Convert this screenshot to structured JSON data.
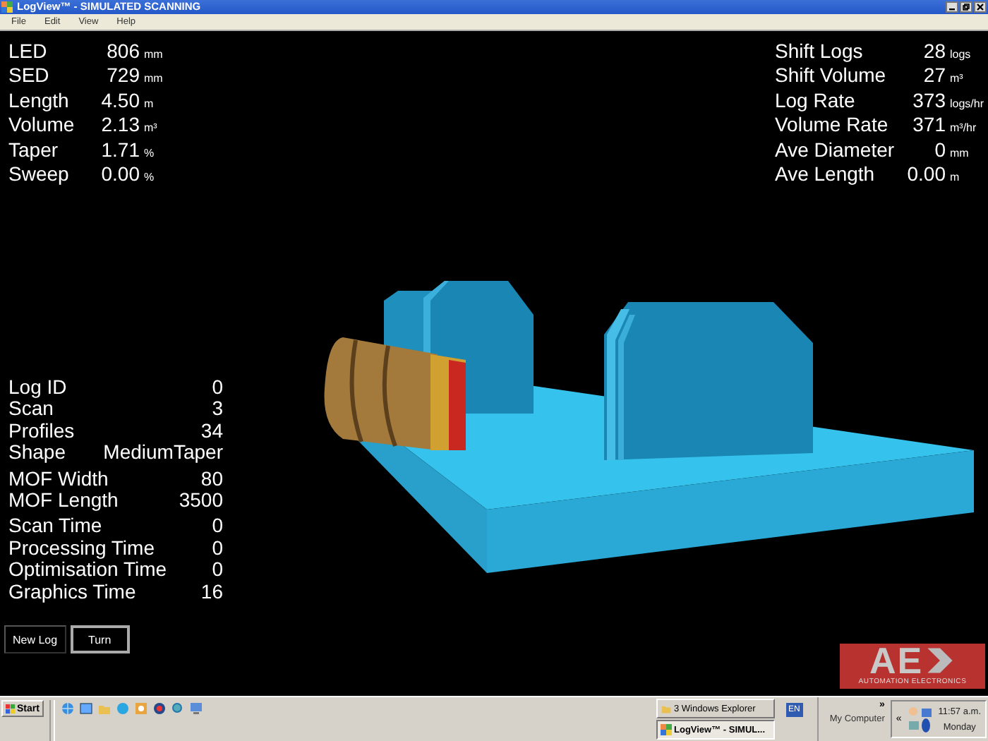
{
  "window": {
    "title": "LogView™ - SIMULATED SCANNING"
  },
  "menu": [
    "File",
    "Edit",
    "View",
    "Help"
  ],
  "log_stats": [
    {
      "label": "LED",
      "value": "806",
      "unit": "mm"
    },
    {
      "label": "SED",
      "value": "729",
      "unit": "mm"
    },
    {
      "label": "Length",
      "value": "4.50",
      "unit": "m"
    },
    {
      "label": "Volume",
      "value": "2.13",
      "unit": "m³"
    },
    {
      "label": "Taper",
      "value": "1.71",
      "unit": "%"
    },
    {
      "label": "Sweep",
      "value": "0.00",
      "unit": "%"
    }
  ],
  "shift_stats": [
    {
      "label": "Shift Logs",
      "value": "28",
      "unit": "logs"
    },
    {
      "label": "Shift Volume",
      "value": "27",
      "unit": "m³"
    },
    {
      "label": "Log Rate",
      "value": "373",
      "unit": "logs/hr"
    },
    {
      "label": "Volume Rate",
      "value": "371",
      "unit": "m³/hr"
    },
    {
      "label": "Ave Diameter",
      "value": "0",
      "unit": "mm"
    },
    {
      "label": "Ave Length",
      "value": "0.00",
      "unit": "m"
    }
  ],
  "scan_info": [
    [
      {
        "label": "Log ID",
        "value": "0"
      },
      {
        "label": "Scan",
        "value": "3"
      },
      {
        "label": "Profiles",
        "value": "34"
      },
      {
        "label": "Shape",
        "value": "MediumTaper"
      }
    ],
    [
      {
        "label": "MOF Width",
        "value": "80"
      },
      {
        "label": "MOF Length",
        "value": "3500"
      }
    ],
    [
      {
        "label": "Scan Time",
        "value": "0"
      },
      {
        "label": "Processing Time",
        "value": "0"
      },
      {
        "label": "Optimisation Time",
        "value": "0"
      },
      {
        "label": "Graphics Time",
        "value": "16"
      }
    ]
  ],
  "buttons": [
    {
      "label": "New Log",
      "focused": false
    },
    {
      "label": "Turn",
      "focused": true
    }
  ],
  "logo": {
    "letters": "AE",
    "tagline": "AUTOMATION ELECTRONICS"
  },
  "taskbar": {
    "start": "Start",
    "tasks": [
      {
        "label": "3 Windows Explorer",
        "kind": "group",
        "selected": false
      },
      {
        "label": "LogView™ - SIMUL...",
        "kind": "window",
        "selected": true
      }
    ],
    "language": "EN",
    "toolbar": "My Computer",
    "toolbar_chevron": "»",
    "tray_chevron": "«",
    "clock": {
      "time": "11:57 a.m.",
      "day": "Monday"
    }
  }
}
